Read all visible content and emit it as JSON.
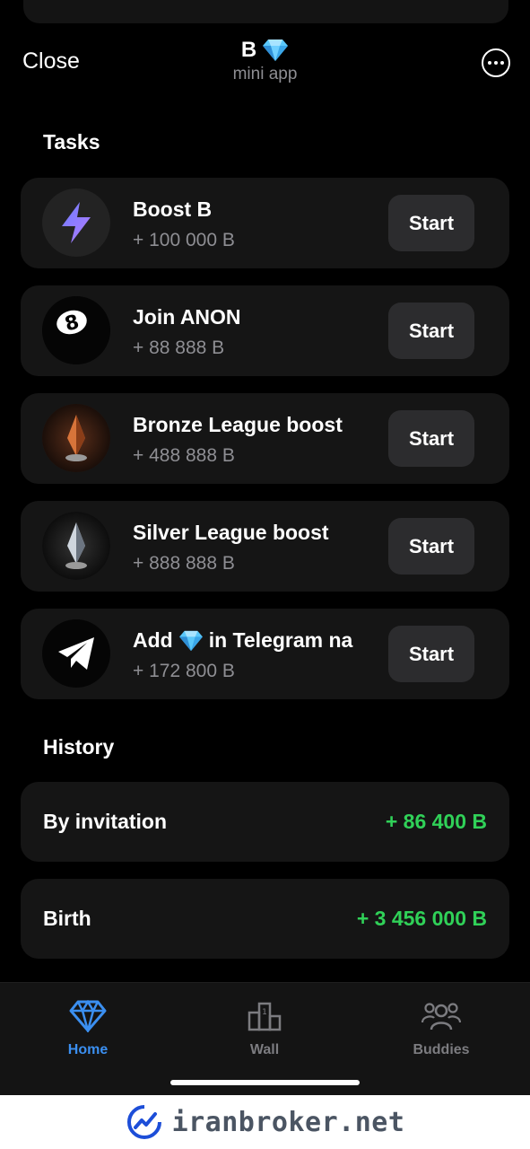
{
  "header": {
    "close_label": "Close",
    "title": "B",
    "title_icon": "diamond-icon",
    "subtitle": "mini app",
    "more_icon": "more-dots-icon"
  },
  "tasks_section": {
    "title": "Tasks",
    "items": [
      {
        "name": "Boost B",
        "reward": "+ 100 000 B",
        "button": "Start",
        "icon": "lightning-icon"
      },
      {
        "name": "Join ANON",
        "reward": "+ 88 888 B",
        "button": "Start",
        "icon": "eight-ball-icon"
      },
      {
        "name": "Bronze League boost",
        "reward": "+ 488 888 B",
        "button": "Start",
        "icon": "bronze-trophy-icon"
      },
      {
        "name": "Silver League boost",
        "reward": "+ 888 888 B",
        "button": "Start",
        "icon": "silver-trophy-icon"
      },
      {
        "name_before": "Add",
        "name_after": "in Telegram na",
        "reward": "+ 172 800 B",
        "button": "Start",
        "icon": "telegram-icon"
      }
    ]
  },
  "history_section": {
    "title": "History",
    "items": [
      {
        "label": "By invitation",
        "value": "+ 86 400 B"
      },
      {
        "label": "Birth",
        "value": "+ 3 456 000 B"
      }
    ]
  },
  "tabbar": {
    "tabs": [
      {
        "label": "Home",
        "icon": "diamond-icon",
        "active": true
      },
      {
        "label": "Wall",
        "icon": "podium-icon",
        "active": false
      },
      {
        "label": "Buddies",
        "icon": "people-icon",
        "active": false
      }
    ]
  },
  "watermark": {
    "text": "iranbroker.net"
  },
  "colors": {
    "accent": "#3b8ff0",
    "positive": "#30d158",
    "card": "#151515",
    "background": "#000000"
  }
}
